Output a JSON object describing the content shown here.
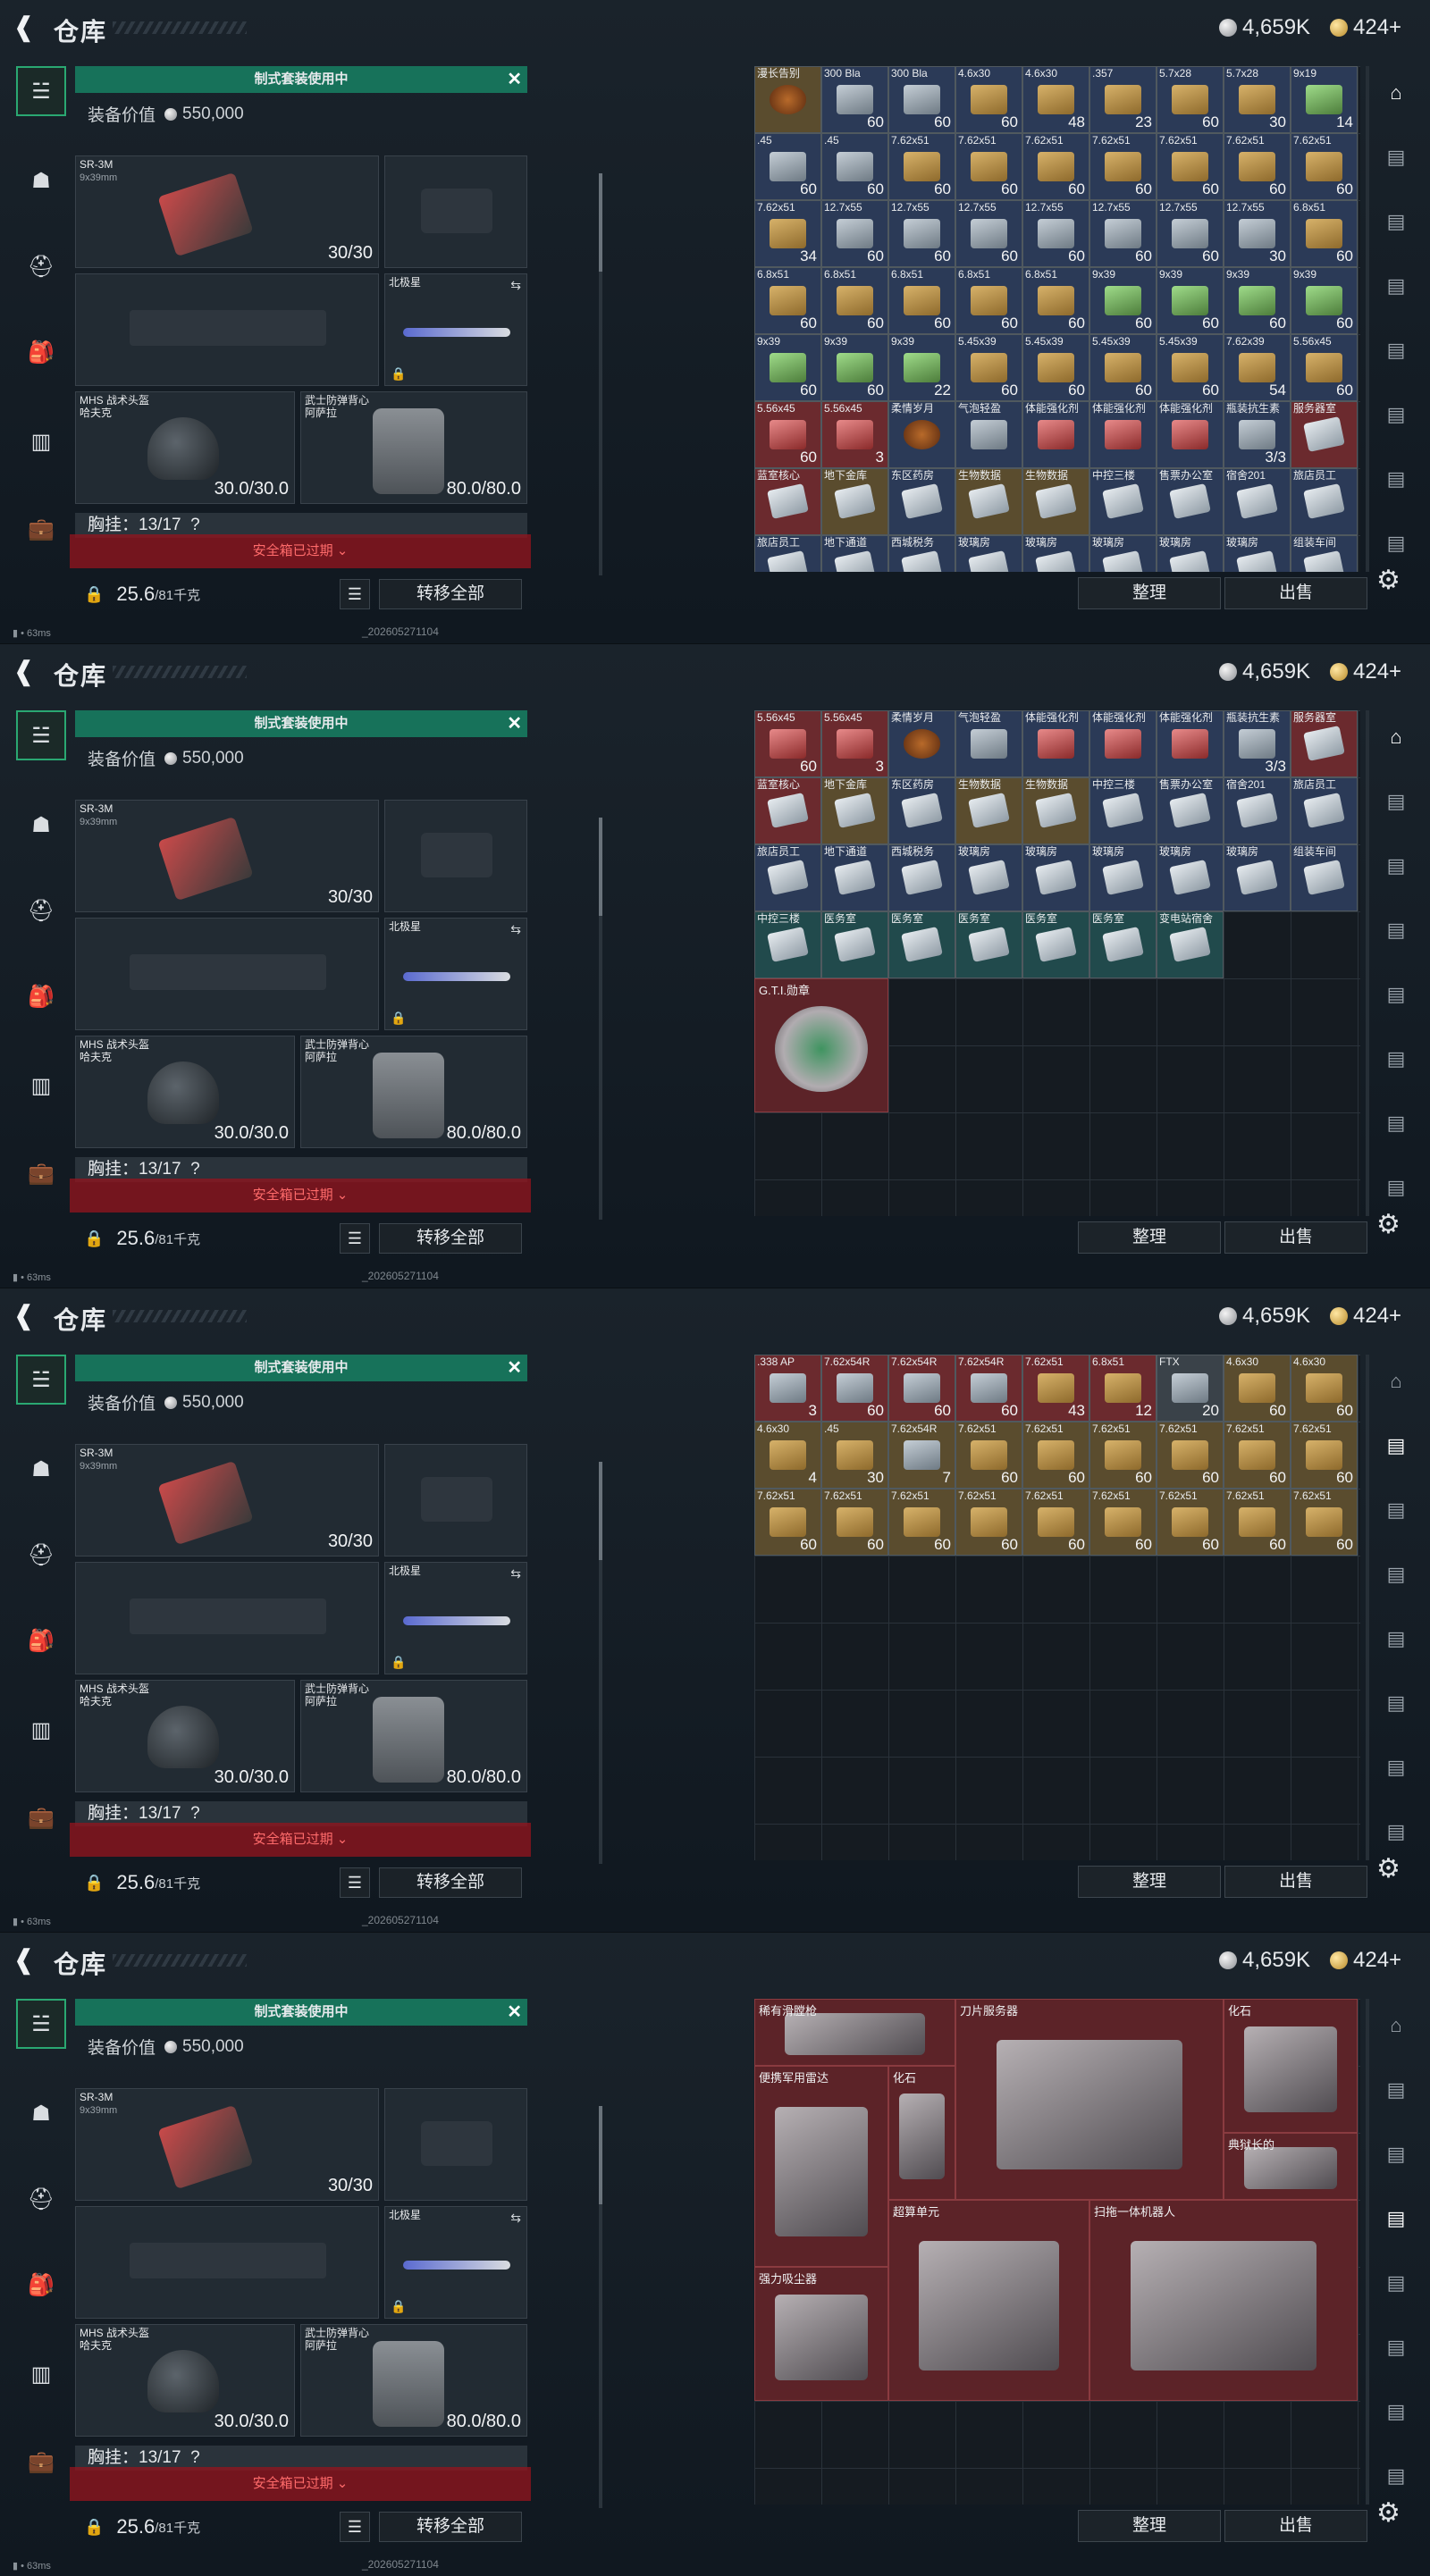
{
  "header": {
    "title": "仓库",
    "silver": "4,659K",
    "gold": "424+"
  },
  "loadout": {
    "banner": "制式套装使用中",
    "equip_value_label": "装备价值",
    "equip_value": "550,000",
    "primary": {
      "name": "SR-3M",
      "caliber": "9x39mm",
      "count": "30/30"
    },
    "melee": {
      "name": "北极星"
    },
    "helmet": {
      "name": "MHS 战术头盔",
      "sub": "哈夫克",
      "durability": "30.0/30.0"
    },
    "armor": {
      "name": "武士防弹背心",
      "sub": "阿萨拉",
      "durability": "80.0/80.0"
    },
    "chest_label": "胸挂：13/17",
    "chest_q": "?",
    "safebox": "安全箱已过期",
    "weight": "25.6",
    "weight_unit": "/81千克",
    "transfer_all": "转移全部"
  },
  "footer": {
    "ping": "63ms",
    "build": "_202605271104"
  },
  "actions": {
    "sort": "整理",
    "sell": "出售"
  },
  "panels": [
    {
      "items": [
        {
          "n": "漫长告别",
          "q": "",
          "c": "rare-gold",
          "p": "drink"
        },
        {
          "n": "300 Bla",
          "q": "60",
          "c": "rare-blue",
          "p": "ammo2"
        },
        {
          "n": "300 Bla",
          "q": "60",
          "c": "rare-blue",
          "p": "ammo2"
        },
        {
          "n": "4.6x30",
          "q": "60",
          "c": "rare-blue",
          "p": "ammo"
        },
        {
          "n": "4.6x30",
          "q": "48",
          "c": "rare-blue",
          "p": "ammo"
        },
        {
          "n": ".357",
          "q": "23",
          "c": "rare-blue",
          "p": "ammo"
        },
        {
          "n": "5.7x28",
          "q": "60",
          "c": "rare-blue",
          "p": "ammo"
        },
        {
          "n": "5.7x28",
          "q": "30",
          "c": "rare-blue",
          "p": "ammo"
        },
        {
          "n": "9x19",
          "q": "14",
          "c": "rare-blue",
          "p": "ammo3"
        },
        {
          "n": ".45",
          "q": "60",
          "c": "rare-blue",
          "p": "ammo2"
        },
        {
          "n": ".45",
          "q": "60",
          "c": "rare-blue",
          "p": "ammo2"
        },
        {
          "n": "7.62x51",
          "q": "60",
          "c": "rare-blue",
          "p": "ammo"
        },
        {
          "n": "7.62x51",
          "q": "60",
          "c": "rare-blue",
          "p": "ammo"
        },
        {
          "n": "7.62x51",
          "q": "60",
          "c": "rare-blue",
          "p": "ammo"
        },
        {
          "n": "7.62x51",
          "q": "60",
          "c": "rare-blue",
          "p": "ammo"
        },
        {
          "n": "7.62x51",
          "q": "60",
          "c": "rare-blue",
          "p": "ammo"
        },
        {
          "n": "7.62x51",
          "q": "60",
          "c": "rare-blue",
          "p": "ammo"
        },
        {
          "n": "7.62x51",
          "q": "60",
          "c": "rare-blue",
          "p": "ammo"
        },
        {
          "n": "7.62x51",
          "q": "34",
          "c": "rare-blue",
          "p": "ammo"
        },
        {
          "n": "12.7x55",
          "q": "60",
          "c": "rare-blue",
          "p": "ammo2"
        },
        {
          "n": "12.7x55",
          "q": "60",
          "c": "rare-blue",
          "p": "ammo2"
        },
        {
          "n": "12.7x55",
          "q": "60",
          "c": "rare-blue",
          "p": "ammo2"
        },
        {
          "n": "12.7x55",
          "q": "60",
          "c": "rare-blue",
          "p": "ammo2"
        },
        {
          "n": "12.7x55",
          "q": "60",
          "c": "rare-blue",
          "p": "ammo2"
        },
        {
          "n": "12.7x55",
          "q": "60",
          "c": "rare-blue",
          "p": "ammo2"
        },
        {
          "n": "12.7x55",
          "q": "30",
          "c": "rare-blue",
          "p": "ammo2"
        },
        {
          "n": "6.8x51",
          "q": "60",
          "c": "rare-blue",
          "p": "ammo"
        },
        {
          "n": "6.8x51",
          "q": "60",
          "c": "rare-blue",
          "p": "ammo"
        },
        {
          "n": "6.8x51",
          "q": "60",
          "c": "rare-blue",
          "p": "ammo"
        },
        {
          "n": "6.8x51",
          "q": "60",
          "c": "rare-blue",
          "p": "ammo"
        },
        {
          "n": "6.8x51",
          "q": "60",
          "c": "rare-blue",
          "p": "ammo"
        },
        {
          "n": "6.8x51",
          "q": "60",
          "c": "rare-blue",
          "p": "ammo"
        },
        {
          "n": "9x39",
          "q": "60",
          "c": "rare-blue",
          "p": "ammo3"
        },
        {
          "n": "9x39",
          "q": "60",
          "c": "rare-blue",
          "p": "ammo3"
        },
        {
          "n": "9x39",
          "q": "60",
          "c": "rare-blue",
          "p": "ammo3"
        },
        {
          "n": "9x39",
          "q": "60",
          "c": "rare-blue",
          "p": "ammo3"
        },
        {
          "n": "9x39",
          "q": "60",
          "c": "rare-blue",
          "p": "ammo3"
        },
        {
          "n": "9x39",
          "q": "60",
          "c": "rare-blue",
          "p": "ammo3"
        },
        {
          "n": "9x39",
          "q": "22",
          "c": "rare-blue",
          "p": "ammo3"
        },
        {
          "n": "5.45x39",
          "q": "60",
          "c": "rare-blue",
          "p": "ammo"
        },
        {
          "n": "5.45x39",
          "q": "60",
          "c": "rare-blue",
          "p": "ammo"
        },
        {
          "n": "5.45x39",
          "q": "60",
          "c": "rare-blue",
          "p": "ammo"
        },
        {
          "n": "5.45x39",
          "q": "60",
          "c": "rare-blue",
          "p": "ammo"
        },
        {
          "n": "7.62x39",
          "q": "54",
          "c": "rare-blue",
          "p": "ammo"
        },
        {
          "n": "5.56x45",
          "q": "60",
          "c": "rare-blue",
          "p": "ammo"
        },
        {
          "n": "5.56x45",
          "q": "60",
          "c": "rare-red",
          "p": "red"
        },
        {
          "n": "5.56x45",
          "q": "3",
          "c": "rare-red",
          "p": "red"
        },
        {
          "n": "柔情岁月",
          "q": "",
          "c": "rare-blue",
          "p": "drink"
        },
        {
          "n": "气泡轻盈",
          "q": "",
          "c": "rare-blue",
          "p": "ammo2"
        },
        {
          "n": "体能强化剂",
          "q": "",
          "c": "rare-blue",
          "p": "red"
        },
        {
          "n": "体能强化剂",
          "q": "",
          "c": "rare-blue",
          "p": "red"
        },
        {
          "n": "体能强化剂",
          "q": "",
          "c": "rare-blue",
          "p": "red"
        },
        {
          "n": "瓶装抗生素",
          "q": "3/3",
          "c": "rare-blue",
          "p": "ammo2"
        },
        {
          "n": "服务器室",
          "q": "",
          "c": "rare-red",
          "p": "card"
        },
        {
          "n": "蓝室核心",
          "q": "",
          "c": "rare-red",
          "p": "card"
        },
        {
          "n": "地下金库",
          "q": "",
          "c": "rare-gold",
          "p": "card"
        },
        {
          "n": "东区药房",
          "q": "",
          "c": "rare-blue",
          "p": "card"
        },
        {
          "n": "生物数据",
          "q": "",
          "c": "rare-gold",
          "p": "card"
        },
        {
          "n": "生物数据",
          "q": "",
          "c": "rare-gold",
          "p": "card"
        },
        {
          "n": "中控三楼",
          "q": "",
          "c": "rare-blue",
          "p": "card"
        },
        {
          "n": "售票办公室",
          "q": "",
          "c": "rare-blue",
          "p": "card"
        },
        {
          "n": "宿舍201",
          "q": "",
          "c": "rare-blue",
          "p": "card"
        },
        {
          "n": "旅店员工",
          "q": "",
          "c": "rare-blue",
          "p": "card"
        },
        {
          "n": "旅店员工",
          "q": "",
          "c": "rare-blue",
          "p": "card"
        },
        {
          "n": "地下通道",
          "q": "",
          "c": "rare-blue",
          "p": "card"
        },
        {
          "n": "西城税务",
          "q": "",
          "c": "rare-blue",
          "p": "card"
        },
        {
          "n": "玻璃房",
          "q": "",
          "c": "rare-blue",
          "p": "card"
        },
        {
          "n": "玻璃房",
          "q": "",
          "c": "rare-blue",
          "p": "card"
        },
        {
          "n": "玻璃房",
          "q": "",
          "c": "rare-blue",
          "p": "card"
        },
        {
          "n": "玻璃房",
          "q": "",
          "c": "rare-blue",
          "p": "card"
        },
        {
          "n": "玻璃房",
          "q": "",
          "c": "rare-blue",
          "p": "card"
        },
        {
          "n": "组装车间",
          "q": "",
          "c": "rare-blue",
          "p": "card"
        }
      ]
    },
    {
      "items": [
        {
          "n": "5.56x45",
          "q": "60",
          "c": "rare-red",
          "p": "red"
        },
        {
          "n": "5.56x45",
          "q": "3",
          "c": "rare-red",
          "p": "red"
        },
        {
          "n": "柔情岁月",
          "q": "",
          "c": "rare-blue",
          "p": "drink"
        },
        {
          "n": "气泡轻盈",
          "q": "",
          "c": "rare-blue",
          "p": "ammo2"
        },
        {
          "n": "体能强化剂",
          "q": "",
          "c": "rare-blue",
          "p": "red"
        },
        {
          "n": "体能强化剂",
          "q": "",
          "c": "rare-blue",
          "p": "red"
        },
        {
          "n": "体能强化剂",
          "q": "",
          "c": "rare-blue",
          "p": "red"
        },
        {
          "n": "瓶装抗生素",
          "q": "3/3",
          "c": "rare-blue",
          "p": "ammo2"
        },
        {
          "n": "服务器室",
          "q": "",
          "c": "rare-red",
          "p": "card"
        },
        {
          "n": "蓝室核心",
          "q": "",
          "c": "rare-red",
          "p": "card"
        },
        {
          "n": "地下金库",
          "q": "",
          "c": "rare-gold",
          "p": "card"
        },
        {
          "n": "东区药房",
          "q": "",
          "c": "rare-blue",
          "p": "card"
        },
        {
          "n": "生物数据",
          "q": "",
          "c": "rare-gold",
          "p": "card"
        },
        {
          "n": "生物数据",
          "q": "",
          "c": "rare-gold",
          "p": "card"
        },
        {
          "n": "中控三楼",
          "q": "",
          "c": "rare-blue",
          "p": "card"
        },
        {
          "n": "售票办公室",
          "q": "",
          "c": "rare-blue",
          "p": "card"
        },
        {
          "n": "宿舍201",
          "q": "",
          "c": "rare-blue",
          "p": "card"
        },
        {
          "n": "旅店员工",
          "q": "",
          "c": "rare-blue",
          "p": "card"
        },
        {
          "n": "旅店员工",
          "q": "",
          "c": "rare-blue",
          "p": "card"
        },
        {
          "n": "地下通道",
          "q": "",
          "c": "rare-blue",
          "p": "card"
        },
        {
          "n": "西城税务",
          "q": "",
          "c": "rare-blue",
          "p": "card"
        },
        {
          "n": "玻璃房",
          "q": "",
          "c": "rare-blue",
          "p": "card"
        },
        {
          "n": "玻璃房",
          "q": "",
          "c": "rare-blue",
          "p": "card"
        },
        {
          "n": "玻璃房",
          "q": "",
          "c": "rare-blue",
          "p": "card"
        },
        {
          "n": "玻璃房",
          "q": "",
          "c": "rare-blue",
          "p": "card"
        },
        {
          "n": "玻璃房",
          "q": "",
          "c": "rare-blue",
          "p": "card"
        },
        {
          "n": "组装车间",
          "q": "",
          "c": "rare-blue",
          "p": "card"
        },
        {
          "n": "中控三楼",
          "q": "",
          "c": "rare-teal",
          "p": "card"
        },
        {
          "n": "医务室",
          "q": "",
          "c": "rare-teal",
          "p": "card"
        },
        {
          "n": "医务室",
          "q": "",
          "c": "rare-teal",
          "p": "card"
        },
        {
          "n": "医务室",
          "q": "",
          "c": "rare-teal",
          "p": "card"
        },
        {
          "n": "医务室",
          "q": "",
          "c": "rare-teal",
          "p": "card"
        },
        {
          "n": "医务室",
          "q": "",
          "c": "rare-teal",
          "p": "card"
        },
        {
          "n": "变电站宿舍",
          "q": "",
          "c": "rare-teal",
          "p": "card"
        }
      ],
      "big": {
        "n": "G.T.I.勋章"
      }
    },
    {
      "items": [
        {
          "n": ".338 AP",
          "q": "3",
          "c": "rare-red",
          "p": "ammo2"
        },
        {
          "n": "7.62x54R",
          "q": "60",
          "c": "rare-red",
          "p": "ammo2"
        },
        {
          "n": "7.62x54R",
          "q": "60",
          "c": "rare-red",
          "p": "ammo2"
        },
        {
          "n": "7.62x54R",
          "q": "60",
          "c": "rare-red",
          "p": "ammo2"
        },
        {
          "n": "7.62x51",
          "q": "43",
          "c": "rare-red",
          "p": "ammo"
        },
        {
          "n": "6.8x51",
          "q": "12",
          "c": "rare-red",
          "p": "ammo"
        },
        {
          "n": "FTX",
          "q": "20",
          "c": "rare-gray",
          "p": "ammo2"
        },
        {
          "n": "4.6x30",
          "q": "60",
          "c": "rare-gold",
          "p": "ammo"
        },
        {
          "n": "4.6x30",
          "q": "60",
          "c": "rare-gold",
          "p": "ammo"
        },
        {
          "n": "4.6x30",
          "q": "4",
          "c": "rare-gold",
          "p": "ammo"
        },
        {
          "n": ".45",
          "q": "30",
          "c": "rare-gold",
          "p": "ammo"
        },
        {
          "n": "7.62x54R",
          "q": "7",
          "c": "rare-gold",
          "p": "ammo2"
        },
        {
          "n": "7.62x51",
          "q": "60",
          "c": "rare-gold",
          "p": "ammo"
        },
        {
          "n": "7.62x51",
          "q": "60",
          "c": "rare-gold",
          "p": "ammo"
        },
        {
          "n": "7.62x51",
          "q": "60",
          "c": "rare-gold",
          "p": "ammo"
        },
        {
          "n": "7.62x51",
          "q": "60",
          "c": "rare-gold",
          "p": "ammo"
        },
        {
          "n": "7.62x51",
          "q": "60",
          "c": "rare-gold",
          "p": "ammo"
        },
        {
          "n": "7.62x51",
          "q": "60",
          "c": "rare-gold",
          "p": "ammo"
        },
        {
          "n": "7.62x51",
          "q": "60",
          "c": "rare-gold",
          "p": "ammo"
        },
        {
          "n": "7.62x51",
          "q": "60",
          "c": "rare-gold",
          "p": "ammo"
        },
        {
          "n": "7.62x51",
          "q": "60",
          "c": "rare-gold",
          "p": "ammo"
        },
        {
          "n": "7.62x51",
          "q": "60",
          "c": "rare-gold",
          "p": "ammo"
        },
        {
          "n": "7.62x51",
          "q": "60",
          "c": "rare-gold",
          "p": "ammo"
        },
        {
          "n": "7.62x51",
          "q": "60",
          "c": "rare-gold",
          "p": "ammo"
        },
        {
          "n": "7.62x51",
          "q": "60",
          "c": "rare-gold",
          "p": "ammo"
        },
        {
          "n": "7.62x51",
          "q": "60",
          "c": "rare-gold",
          "p": "ammo"
        },
        {
          "n": "7.62x51",
          "q": "60",
          "c": "rare-gold",
          "p": "ammo"
        }
      ]
    },
    {
      "bigs": [
        {
          "n": "稀有滑膛枪"
        },
        {
          "n": "刀片服务器"
        },
        {
          "n": "化石"
        },
        {
          "n": "便携军用雷达"
        },
        {
          "n": "化石"
        },
        {
          "n": "典狱长的"
        },
        {
          "n": "超算单元"
        },
        {
          "n": "扫拖一体机器人"
        },
        {
          "n": "强力吸尘器"
        }
      ]
    }
  ],
  "icons": {
    "nav": [
      "pistol-icon",
      "armor-icon",
      "helmet-icon",
      "backpack-icon",
      "chest-rig-icon",
      "briefcase-icon"
    ],
    "strip": [
      "home-icon",
      "tab1-icon",
      "tab2-icon",
      "tab3-icon",
      "tab4-icon",
      "tab5-icon",
      "tab6-icon",
      "tab7-icon"
    ]
  },
  "colors": {
    "banner": "#17725a",
    "safebox": "#961420",
    "rare_red": "#6b2a2e",
    "rare_blue": "#2b3a57",
    "rare_gold": "#5a4c2e"
  }
}
